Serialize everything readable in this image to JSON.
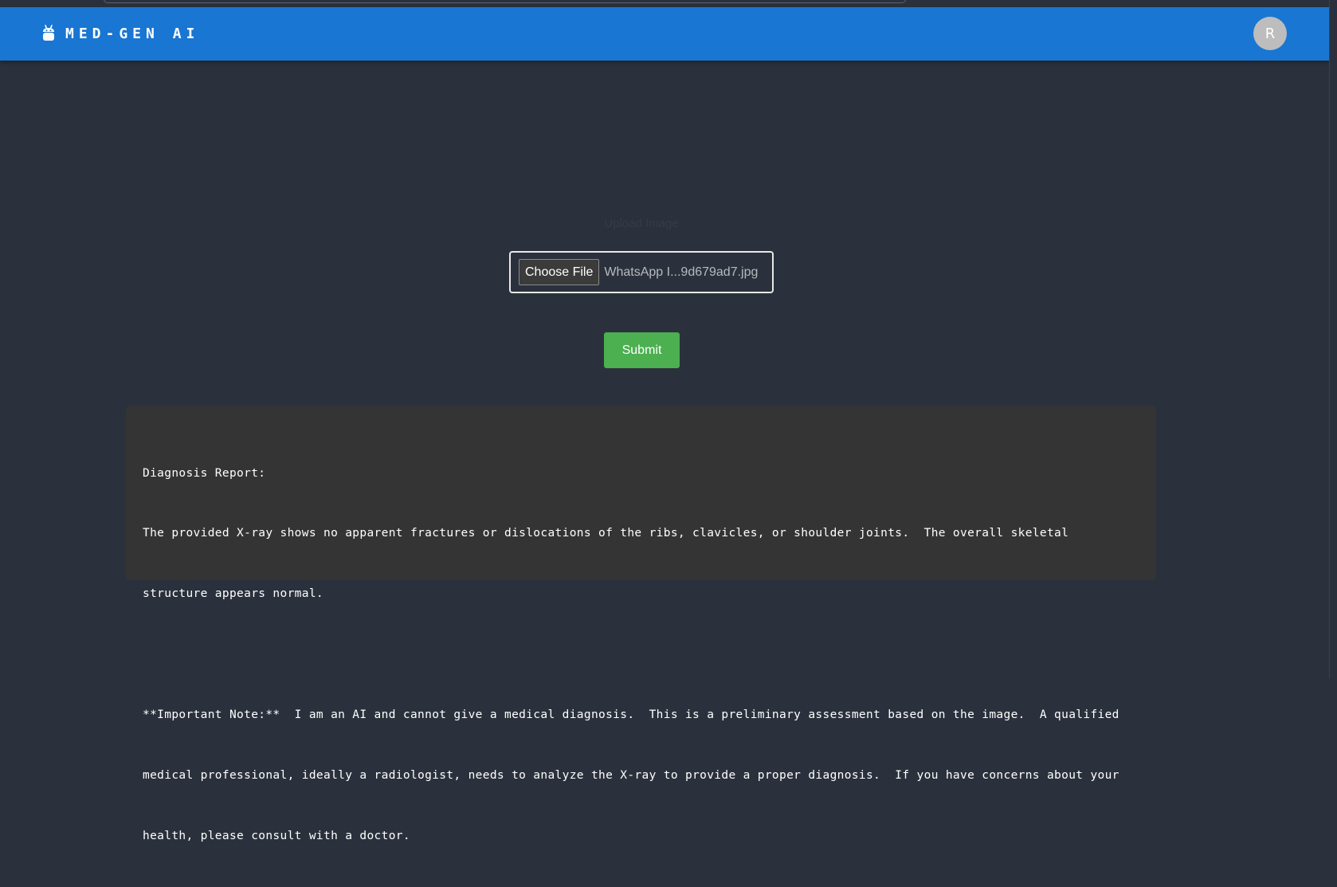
{
  "app": {
    "brand": "MED-GEN AI",
    "logo_icon": "robot-icon",
    "user_avatar_initial": "R"
  },
  "upload": {
    "label": "Upload Image",
    "choose_button": "Choose File",
    "file_name": "WhatsApp I...9d679ad7.jpg",
    "submit_button": "Submit"
  },
  "report": {
    "lines": [
      "Diagnosis Report:",
      "The provided X-ray shows no apparent fractures or dislocations of the ribs, clavicles, or shoulder joints.  The overall skeletal",
      "structure appears normal.",
      "",
      "**Important Note:**  I am an AI and cannot give a medical diagnosis.  This is a preliminary assessment based on the image.  A qualified",
      "medical professional, ideally a radiologist, needs to analyze the X-ray to provide a proper diagnosis.  If you have concerns about your",
      "health, please consult with a doctor."
    ]
  },
  "colors": {
    "background": "#2b313c",
    "navbar": "#1976d2",
    "submit": "#4caf50",
    "report_bg": "#343434",
    "avatar": "#bdbdbd"
  }
}
